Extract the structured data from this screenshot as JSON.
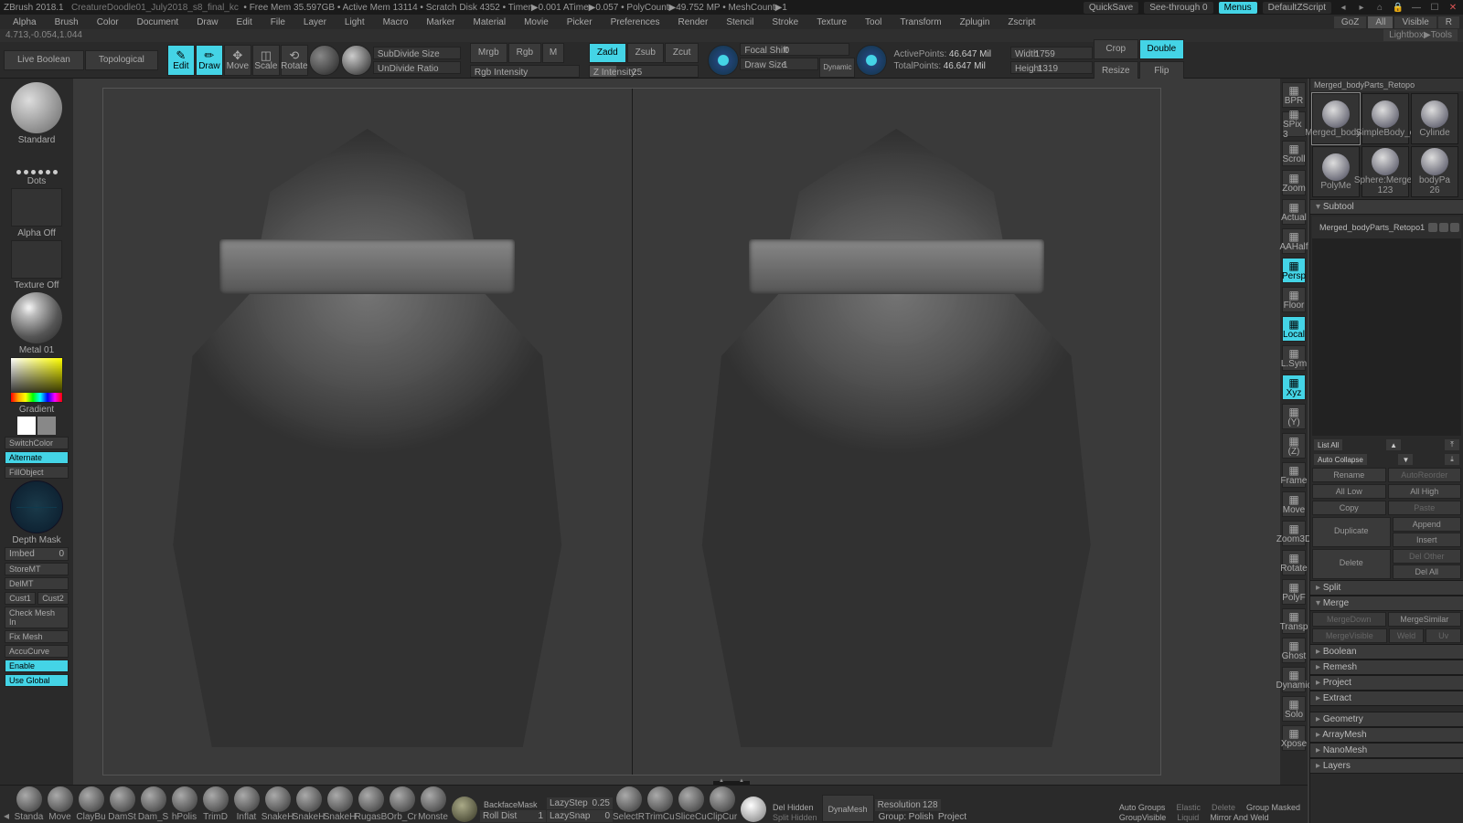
{
  "titlebar": {
    "app": "ZBrush 2018.1",
    "file": "CreatureDoodle01_July2018_s8_final_kc",
    "stats": "• Free Mem 35.597GB • Active Mem 13114 • Scratch Disk 4352 • Timer▶0.001 ATime▶0.057 • PolyCount▶49.752 MP  • MeshCount▶1",
    "quicksave": "QuickSave",
    "seethrough": "See-through  0",
    "menus": "Menus",
    "defaultscript": "DefaultZScript"
  },
  "menu": [
    "Alpha",
    "Brush",
    "Color",
    "Document",
    "Draw",
    "Edit",
    "File",
    "Layer",
    "Light",
    "Macro",
    "Marker",
    "Material",
    "Movie",
    "Picker",
    "Preferences",
    "Render",
    "Stencil",
    "Stroke",
    "Texture",
    "Tool",
    "Transform",
    "Zplugin",
    "Zscript"
  ],
  "right_tabs": {
    "goz": "GoZ",
    "all": "All",
    "visible": "Visible",
    "r": "R"
  },
  "coords": "4.713,-0.054,1.044",
  "lightbox": "Lightbox▶Tools",
  "toolname": "Merged_bodyParts_Retopo",
  "toolbar": {
    "liveBool": "Live Boolean",
    "topol": "Topological",
    "edit": "Edit",
    "draw": "Draw",
    "move": "Move",
    "scale": "Scale",
    "rotate": "Rotate",
    "subdivideSize": "SubDivide Size",
    "undivideRatio": "UnDivide Ratio",
    "mrgb": "Mrgb",
    "rgb": "Rgb",
    "m": "M",
    "rgbIntensity": "Rgb Intensity",
    "zadd": "Zadd",
    "zsub": "Zsub",
    "zcut": "Zcut",
    "zintensity_lbl": "Z Intensity",
    "zintensity_val": "25",
    "focalShift": "Focal Shift",
    "focalShift_val": "0",
    "drawSize": "Draw Size",
    "drawSize_val": "1",
    "dynamic": "Dynamic",
    "activePoints_lbl": "ActivePoints:",
    "activePoints_val": "46.647 Mil",
    "totalPoints_lbl": "TotalPoints:",
    "totalPoints_val": "46.647 Mil",
    "width_lbl": "Width",
    "width_val": "1759",
    "height_lbl": "Height",
    "height_val": "1319",
    "crop": "Crop",
    "resize": "Resize",
    "double": "Double",
    "flip": "Flip"
  },
  "left": {
    "brush": "Standard",
    "stroke": "Dots",
    "alpha": "Alpha Off",
    "texture": "Texture Off",
    "material": "Metal 01",
    "gradient": "Gradient",
    "switch": "SwitchColor",
    "alternate": "Alternate",
    "fill": "FillObject",
    "depth": "Depth Mask",
    "imbed_lbl": "Imbed",
    "imbed_val": "0",
    "storeMT": "StoreMT",
    "delMT": "DelMT",
    "cust1": "Cust1",
    "cust2": "Cust2",
    "checkmesh": "Check Mesh In",
    "fixmesh": "Fix Mesh",
    "accucurve": "AccuCurve",
    "enable": "Enable",
    "useglobal": "Use Global"
  },
  "rightstrip": [
    "BPR",
    "SPix 3",
    "Scroll",
    "Zoom",
    "Actual",
    "AAHalf",
    "Persp",
    "Floor",
    "Local",
    "L.Sym",
    "Xyz",
    "(Y)",
    "(Z)",
    "Frame",
    "Move",
    "Zoom3D",
    "Rotate",
    "PolyF",
    "Transp",
    "Ghost",
    "Dynamic",
    "Solo",
    "Xpose"
  ],
  "rightstrip_on": [
    6,
    8,
    10
  ],
  "tools": [
    {
      "name": "Merged_bodyP"
    },
    {
      "name": "SimpleBody_o"
    },
    {
      "name": "Cylinde"
    },
    {
      "name": "PolyMe"
    },
    {
      "name": "Sphere:Mergec",
      "val": "123"
    },
    {
      "name": "bodyPa",
      "val": "26"
    }
  ],
  "subtool_title": "Subtool",
  "subtool_item": "Merged_bodyParts_Retopo1",
  "listall": "List All",
  "autocollapse": "Auto Collapse",
  "btns": {
    "rename": "Rename",
    "autoreorder": "AutoReorder",
    "alllow": "All Low",
    "allhigh": "All High",
    "copy": "Copy",
    "paste": "Paste",
    "duplicate": "Duplicate",
    "append": "Append",
    "insert": "Insert",
    "delete": "Delete",
    "delother": "Del Other",
    "delall": "Del All",
    "split": "Split",
    "merge": "Merge",
    "mergedown": "MergeDown",
    "mergesimilar": "MergeSimilar",
    "mergevisible": "MergeVisible",
    "weld": "Weld",
    "uv": "Uv",
    "boolean": "Boolean",
    "remesh": "Remesh",
    "project": "Project",
    "extract": "Extract"
  },
  "sections": [
    "Geometry",
    "ArrayMesh",
    "NanoMesh",
    "Layers"
  ],
  "bottom": {
    "brushes": [
      "Standa",
      "Move",
      "ClayBu",
      "DamSt",
      "Dam_S",
      "hPolis",
      "TrimD",
      "Inflat",
      "SnakeH",
      "SnakeH",
      "SnakeH",
      "RugasB",
      "Orb_Cr",
      "Monste"
    ],
    "backface": "BackfaceMask",
    "rolldist_lbl": "Roll Dist",
    "rolldist_val": "1",
    "lazystep_lbl": "LazyStep",
    "lazystep_val": "0.25",
    "lazysnap_lbl": "LazySnap",
    "lazysnap_val": "0",
    "selrect": "SelectR",
    "trimcu": "TrimCu",
    "slicecu": "SliceCu",
    "clipcu": "ClipCur",
    "delhidden": "Del Hidden",
    "splithidden": "Split Hidden",
    "dynamesh": "DynaMesh",
    "resolution_lbl": "Resolution",
    "resolution_val": "128",
    "group": "Group:",
    "polish": "Polish",
    "project": "Project",
    "autogroups": "Auto Groups",
    "elastic": "Elastic",
    "delete": "Delete",
    "groupmasked": "Group Masked",
    "groupvisible": "GroupVisible",
    "liquid": "Liquid",
    "mirror": "Mirror And Weld"
  }
}
